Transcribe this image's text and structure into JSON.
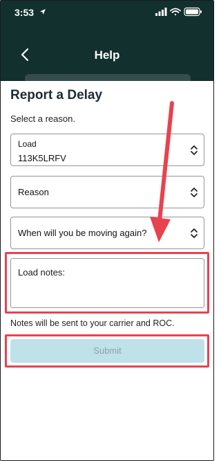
{
  "status_bar": {
    "time": "3:53"
  },
  "nav": {
    "title": "Help"
  },
  "page": {
    "title": "Report a Delay",
    "prompt": "Select a reason."
  },
  "form": {
    "load": {
      "label": "Load",
      "value": "113K5LRFV"
    },
    "reason": {
      "placeholder": "Reason"
    },
    "moving_again": {
      "placeholder": "When will you be moving again?"
    },
    "notes": {
      "placeholder": "Load notes:"
    },
    "notice": "Notes will be sent to your carrier and ROC.",
    "submit_label": "Submit"
  },
  "colors": {
    "header": "#12302e",
    "annotation": "#e8424f",
    "submit_bg": "#bfe1e8",
    "submit_text": "#8d9fa6"
  },
  "icons": [
    "location-arrow-icon",
    "signal-icon",
    "wifi-icon",
    "battery-icon",
    "back-chevron-icon",
    "up-down-chevron-icon"
  ]
}
